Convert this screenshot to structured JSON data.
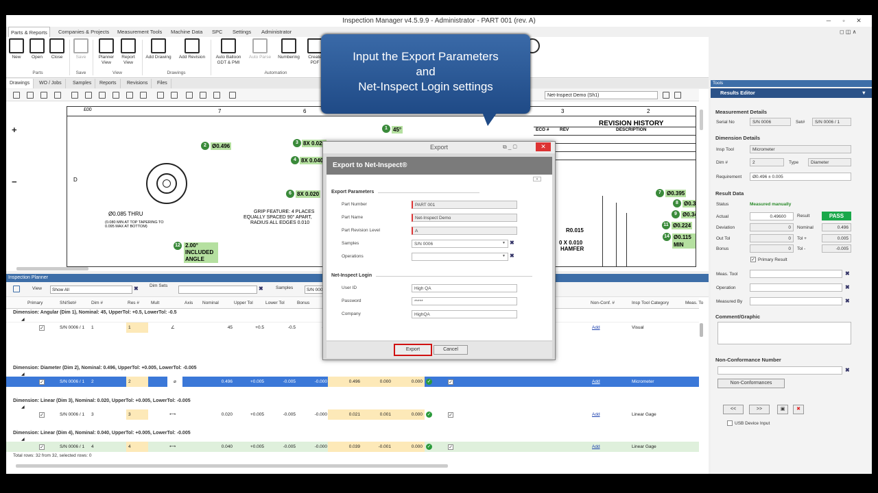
{
  "window": {
    "title": "Inspection Manager v4.5.9.9 - Administrator  -  PART 001 (rev. A)"
  },
  "menu": [
    "Parts & Reports",
    "Companies & Projects",
    "Measurement Tools",
    "Machine Data",
    "SPC",
    "Settings",
    "Administrator"
  ],
  "ribbon": {
    "buttons": [
      {
        "label": "New",
        "icon": "new-file-icon"
      },
      {
        "label": "Open",
        "icon": "folder-open-icon"
      },
      {
        "label": "Close",
        "icon": "close-file-icon"
      },
      {
        "label": "Save",
        "icon": "save-icon"
      },
      {
        "label": "Planner View",
        "icon": "planner-icon"
      },
      {
        "label": "Report View",
        "icon": "report-icon"
      },
      {
        "label": "Add Drawing",
        "icon": "add-drawing-icon"
      },
      {
        "label": "Add Revision",
        "icon": "add-revision-icon"
      },
      {
        "label": "Auto Balloon GDT & PMI",
        "icon": "auto-balloon-icon"
      },
      {
        "label": "Auto Parse",
        "icon": "auto-parse-icon"
      },
      {
        "label": "Numbering",
        "icon": "numbering-icon"
      },
      {
        "label": "Create PDF",
        "icon": "pdf-icon"
      }
    ],
    "groups": [
      "Parts",
      "Save",
      "View",
      "Drawings",
      "Automation"
    ]
  },
  "doctabs": [
    "Drawings",
    "WO / Jobs",
    "Samples",
    "Reports",
    "Revisions",
    "Files"
  ],
  "drawing": {
    "sheet_select": "Net-Inspect Demo (Sh1)",
    "zone_cols": [
      "7",
      "6",
      "3",
      "2"
    ],
    "zone_row": "D",
    "revision_title": "REVISION HISTORY",
    "rev_cols": [
      "ECO #",
      "REV",
      "DESCRIPTION"
    ],
    "balloons": [
      {
        "n": "1",
        "tag": "45°"
      },
      {
        "n": "2",
        "tag": "Ø0.496"
      },
      {
        "n": "3",
        "tag": "8X 0.020"
      },
      {
        "n": "4",
        "tag": "8X 0.040"
      },
      {
        "n": "6",
        "tag": "8X 0.020"
      },
      {
        "n": "7",
        "tag": "Ø0.395"
      },
      {
        "n": "8",
        "tag": "Ø0.375"
      },
      {
        "n": "9",
        "tag": "Ø0.340"
      },
      {
        "n": "11",
        "tag": "Ø0.224"
      },
      {
        "n": "14",
        "tag": "Ø0.115 MIN"
      },
      {
        "n": "12",
        "tag": "2.00° INCLUDED ANGLE"
      }
    ],
    "notes": [
      "Ø0.085 THRU",
      "(0.080 MIN AT TOP TAPERING TO 0.095 MAX AT BOTTOM)",
      "GRIP FEATURE: 4 PLACES",
      "EQUALLY SPACED 90° APART,",
      "RADIUS ALL EDGES 0.010",
      "R0.015",
      "0 X 0.010",
      "HAMFER"
    ]
  },
  "callout": {
    "line1": "Input the Export Parameters",
    "line2": "and",
    "line3": "Net-Inspect Login settings"
  },
  "planner": {
    "title": "Inspection Planner",
    "view_label": "View",
    "view_value": "Show All",
    "dimsets_label": "Dim Sets",
    "samples_label": "Samples",
    "samples_value": "S/N 000",
    "columns": [
      "Primary",
      "SN/Set#",
      "Dim #",
      "Res #",
      "Mult",
      "Axis",
      "Nominal",
      "Upper Tol",
      "Lower Tol",
      "Bonus",
      "Non-Conf. #",
      "Insp Tool Category",
      "Meas. To"
    ],
    "groups": [
      {
        "header": "Dimension: Angular (Dim 1),   Nominal: 45,   UpperTol: +0.5,   LowerTol: -0.5",
        "row": {
          "sn": "S/N 0006 / 1",
          "dim": "1",
          "res": "1",
          "nominal": "45",
          "upper": "+0.5",
          "lower": "-0.5",
          "bonus": "-0.",
          "actual": "",
          "dev": "",
          "out": "",
          "tool": "Visual",
          "add": "Add",
          "selected": false
        }
      },
      {
        "header": "Dimension: Diameter (Dim 2),   Nominal: 0.496,   UpperTol: +0.005,   LowerTol: -0.005",
        "row": {
          "sn": "S/N 0006 / 1",
          "dim": "2",
          "res": "2",
          "nominal": "0.496",
          "upper": "+0.005",
          "lower": "-0.005",
          "bonus": "-0.000",
          "actual": "0.496",
          "dev": "0.000",
          "out": "0.000",
          "tool": "Micrometer",
          "add": "Add",
          "selected": true
        }
      },
      {
        "header": "Dimension: Linear (Dim 3),   Nominal: 0.020,   UpperTol: +0.005,   LowerTol: -0.005",
        "row": {
          "sn": "S/N 0006 / 1",
          "dim": "3",
          "res": "3",
          "nominal": "0.020",
          "upper": "+0.005",
          "lower": "-0.005",
          "bonus": "-0.000",
          "actual": "0.021",
          "dev": "0.001",
          "out": "0.000",
          "tool": "Linear Gage",
          "add": "Add",
          "selected": false
        }
      },
      {
        "header": "Dimension: Linear (Dim 4),   Nominal: 0.040,   UpperTol: +0.005,   LowerTol: -0.005",
        "row": {
          "sn": "S/N 0006 / 1",
          "dim": "4",
          "res": "4",
          "nominal": "0.040",
          "upper": "+0.005",
          "lower": "-0.005",
          "bonus": "-0.000",
          "actual": "0.039",
          "dev": "-0.001",
          "out": "0.000",
          "tool": "Linear Gage",
          "add": "Add",
          "selected": false
        }
      }
    ],
    "footer": "Total rows: 32 from 32, selected rows: 0"
  },
  "tools": {
    "title": "Tools",
    "editor": "Results Editor",
    "measurement_details": "Measurement Details",
    "serial_label": "Serial No",
    "serial_value": "S/N 0006",
    "set_label": "Set#",
    "set_value": "S/N 0006 / 1",
    "dimension_details": "Dimension Details",
    "insp_tool_label": "Insp Tool",
    "insp_tool_value": "Micrometer",
    "dim_label": "Dim #",
    "dim_value": "2",
    "type_label": "Type",
    "type_value": "Diameter",
    "req_label": "Requirement",
    "req_value": "Ø0.496  ±  0.005",
    "result_data": "Result Data",
    "status_label": "Status",
    "status_value": "Measured manually",
    "actual_label": "Actual",
    "actual_value": "0.49600",
    "result_label": "Result",
    "result_value": "PASS",
    "deviation_label": "Deviation",
    "deviation_value": "0",
    "nominal_label": "Nominal",
    "nominal_value": "0.496",
    "outtol_label": "Out Tol",
    "outtol_value": "0",
    "tolplus_label": "Tol +",
    "tolplus_value": "0.005",
    "bonus_label": "Bonus",
    "bonus_value": "0",
    "tolminus_label": "Tol -",
    "tolminus_value": "-0.005",
    "primary_result": "Primary Result",
    "meas_tool_label": "Meas. Tool",
    "operation_label": "Operation",
    "measured_by_label": "Measured By",
    "comment_label": "Comment/Graphic",
    "nc_label": "Non-Conformance Number",
    "nc_button": "Non-Conformances",
    "prev": "<<",
    "next": ">>",
    "usb": "USB Device Input"
  },
  "dialog": {
    "window_title": "Export",
    "header": "Export to Net-Inspect®",
    "export_params": "Export Parameters",
    "part_number_label": "Part Number",
    "part_number": "PART 001",
    "part_name_label": "Part Name",
    "part_name": "Net-Inspect Demo",
    "rev_label": "Part Revision Level",
    "rev": "A",
    "samples_label": "Samples",
    "samples": "S/N 0006",
    "operations_label": "Operations",
    "operations": "",
    "login": "Net-Inspect Login",
    "user_label": "User ID",
    "user": "High QA",
    "password_label": "Password",
    "password": "*****",
    "company_label": "Company",
    "company": "HighQA",
    "export_btn": "Export",
    "cancel_btn": "Cancel"
  }
}
